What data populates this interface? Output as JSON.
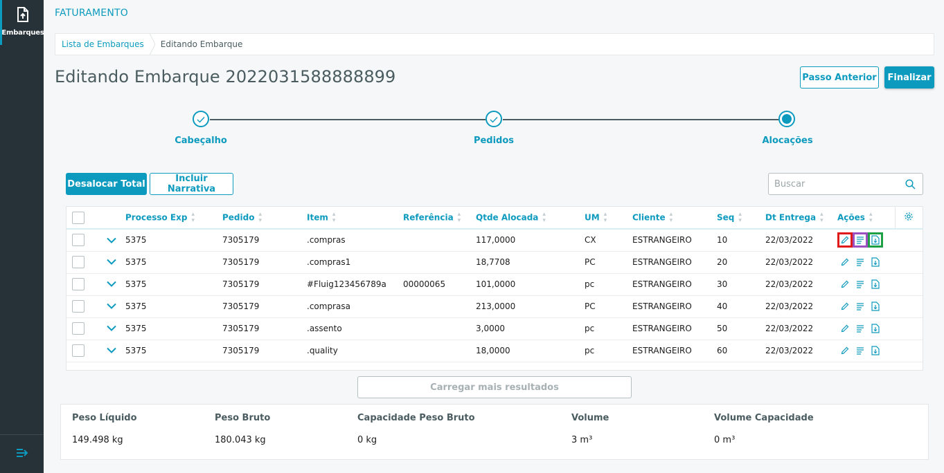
{
  "sidebar": {
    "items": [
      {
        "label": "Embarques",
        "icon": "upload-file-icon"
      }
    ],
    "collapse_icon": "collapse-menu-icon"
  },
  "header": {
    "app_title": "FATURAMENTO",
    "breadcrumb": [
      "Lista de Embarques",
      "Editando Embarque"
    ],
    "page_title": "Editando Embarque 2022031588888899",
    "buttons": {
      "previous": "Passo Anterior",
      "finish": "Finalizar"
    }
  },
  "stepper": {
    "steps": [
      {
        "label": "Cabeçalho",
        "state": "done"
      },
      {
        "label": "Pedidos",
        "state": "done"
      },
      {
        "label": "Alocações",
        "state": "active"
      }
    ]
  },
  "toolbar": {
    "deallocate_label": "Desalocar Total",
    "narrative_label": "Incluir Narrativa",
    "search_placeholder": "Buscar"
  },
  "table": {
    "columns": [
      "Processo Exp",
      "Pedido",
      "Item",
      "Referência",
      "Qtde Alocada",
      "UM",
      "Cliente",
      "Seq",
      "Dt Entrega",
      "Ações"
    ],
    "rows": [
      [
        "5375",
        "7305179",
        ".compras",
        "",
        "117,0000",
        "CX",
        "ESTRANGEIRO",
        "10",
        "22/03/2022"
      ],
      [
        "5375",
        "7305179",
        ".compras1",
        "",
        "18,7708",
        "PC",
        "ESTRANGEIRO",
        "20",
        "22/03/2022"
      ],
      [
        "5375",
        "7305179",
        "#Fluig123456789a",
        "00000065",
        "101,0000",
        "pc",
        "ESTRANGEIRO",
        "30",
        "22/03/2022"
      ],
      [
        "5375",
        "7305179",
        ".comprasa",
        "",
        "213,0000",
        "PC",
        "ESTRANGEIRO",
        "40",
        "22/03/2022"
      ],
      [
        "5375",
        "7305179",
        ".assento",
        "",
        "3,0000",
        "pc",
        "ESTRANGEIRO",
        "50",
        "22/03/2022"
      ],
      [
        "5375",
        "7305179",
        ".quality",
        "",
        "18,0000",
        "pc",
        "ESTRANGEIRO",
        "60",
        "22/03/2022"
      ]
    ],
    "action_icons": [
      "edit-icon",
      "narrative-icon",
      "download-file-icon"
    ],
    "load_more_label": "Carregar mais resultados"
  },
  "summary": {
    "items": [
      {
        "label": "Peso Líquido",
        "value": "149.498 kg"
      },
      {
        "label": "Peso Bruto",
        "value": "180.043 kg"
      },
      {
        "label": "Capacidade Peso Bruto",
        "value": "0 kg"
      },
      {
        "label": "Volume",
        "value": "3 m³"
      },
      {
        "label": "Volume Capacidade",
        "value": "0 m³"
      }
    ]
  },
  "colors": {
    "primary": "#0c9abe",
    "sidebar": "#263238",
    "title_text": "#4a5c60",
    "highlight_edit": "#e01919",
    "highlight_narrative": "#9b4fc0",
    "highlight_download": "#1e9e45"
  }
}
